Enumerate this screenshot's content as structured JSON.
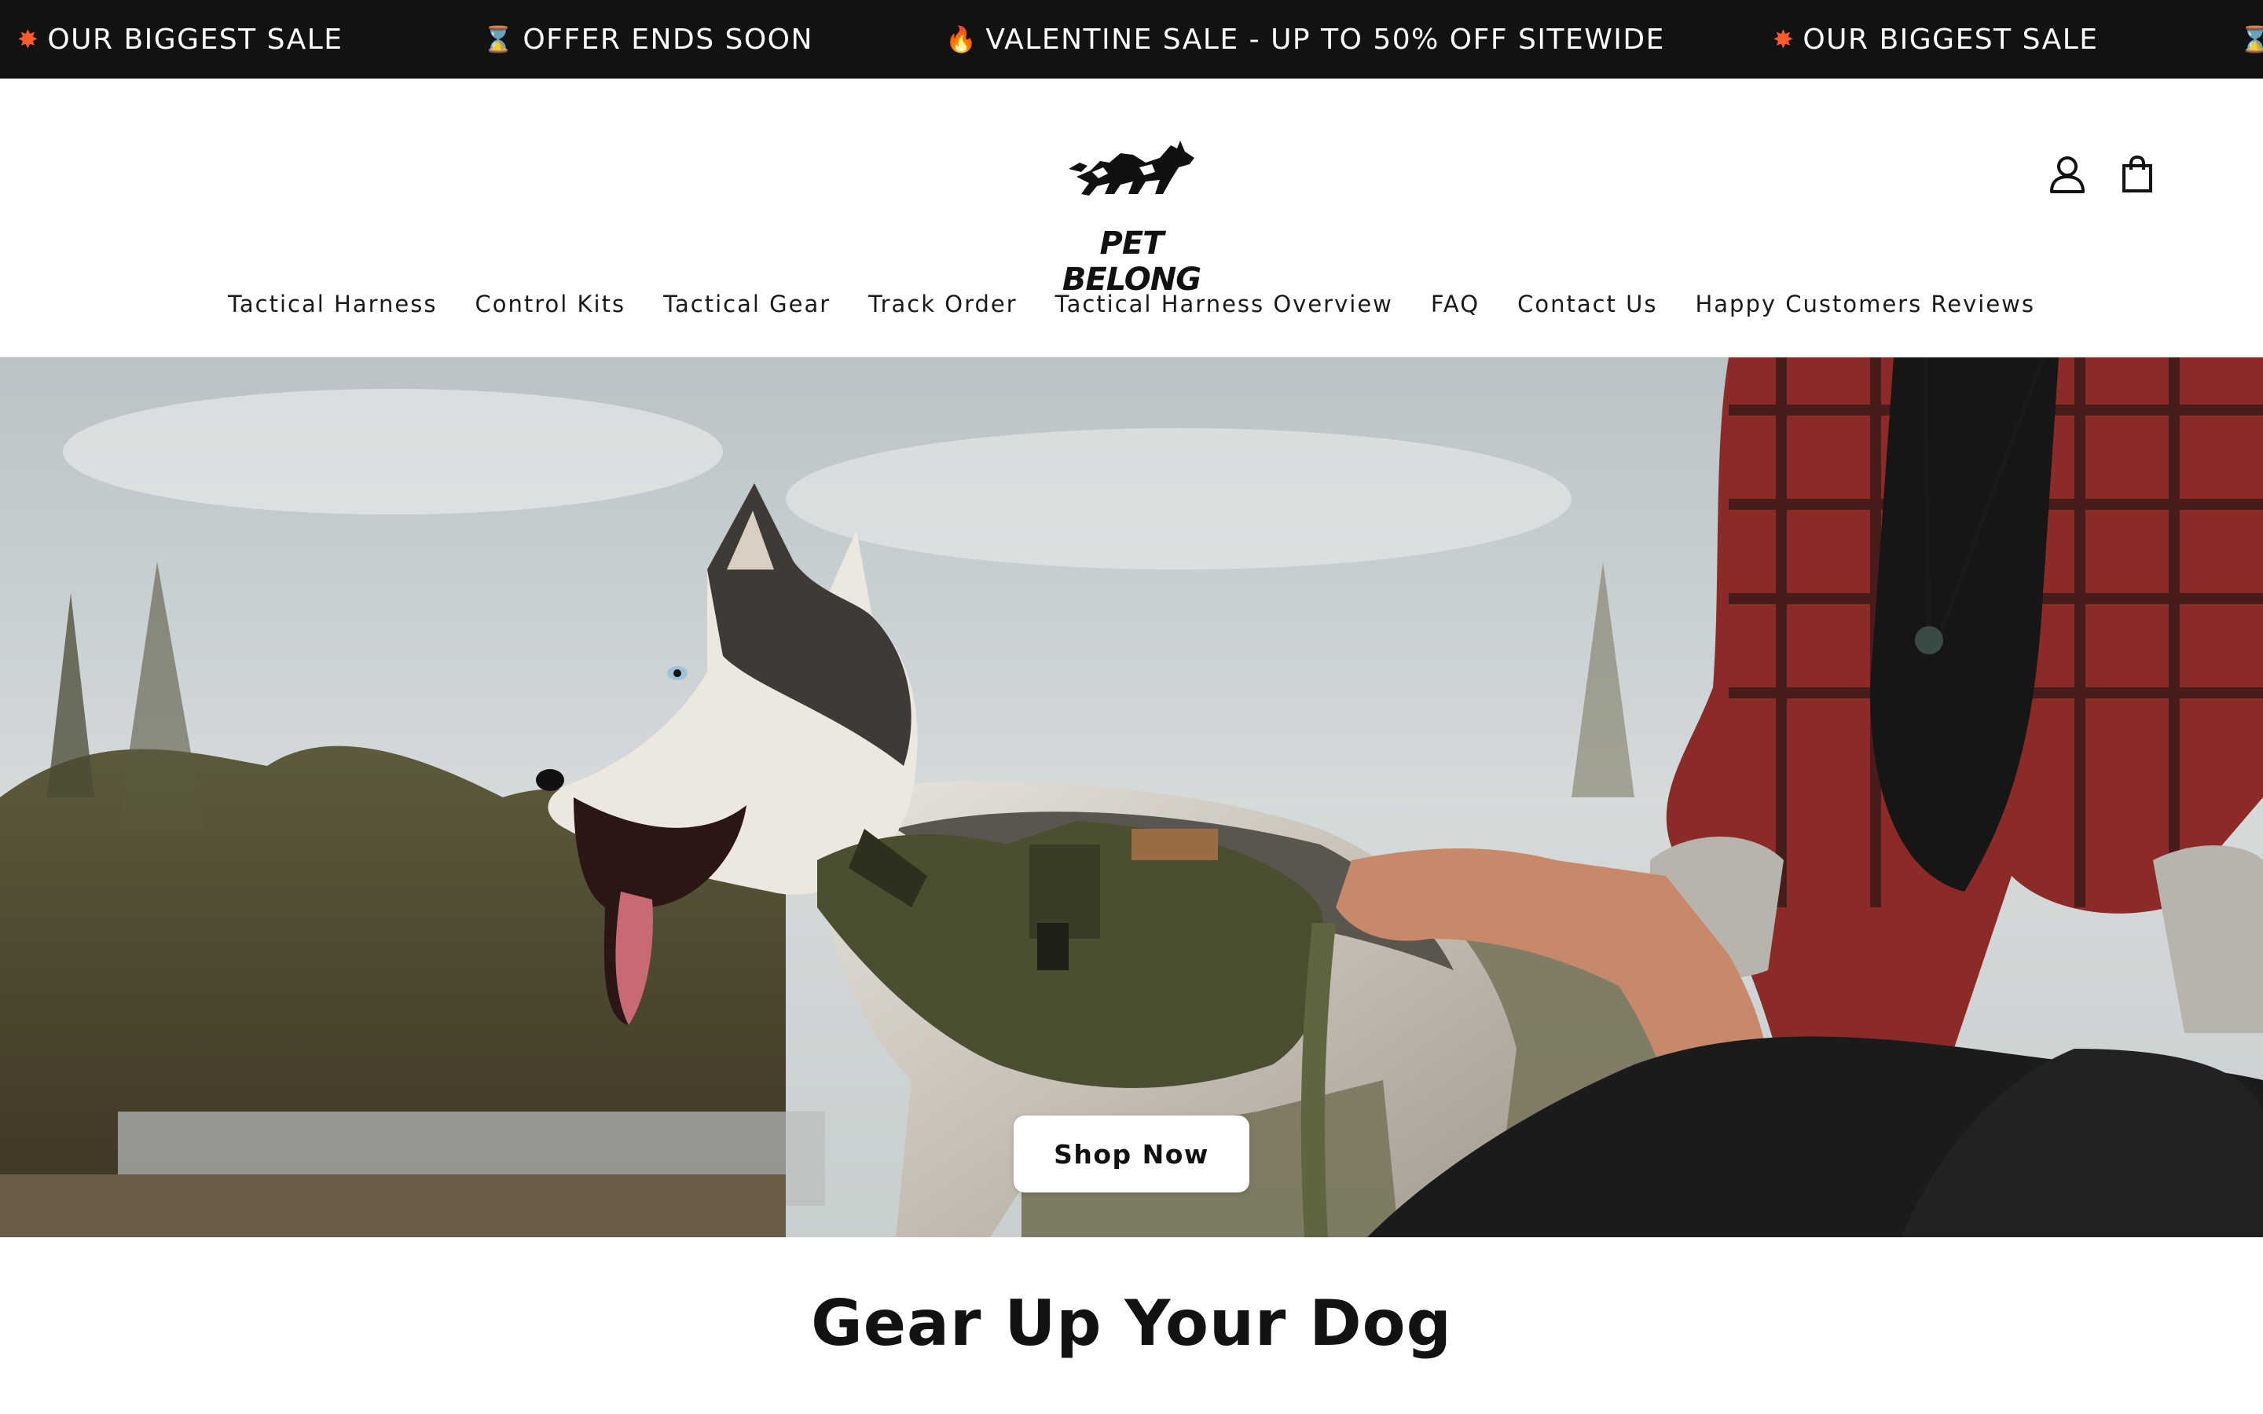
{
  "announcement": {
    "messages": [
      {
        "icon": "burst-icon",
        "text": "OUR BIGGEST SALE"
      },
      {
        "icon": "hourglass-icon",
        "text": "OFFER ENDS SOON"
      },
      {
        "icon": "fire-icon",
        "text": "VALENTINE SALE - UP TO 50% OFF SITEWIDE"
      },
      {
        "icon": "burst-icon",
        "text": "OUR BIGGEST SALE"
      }
    ]
  },
  "header": {
    "logo_text": "PET BELONG",
    "account_icon": "account-icon",
    "cart_icon": "cart-icon"
  },
  "nav": {
    "items": [
      {
        "label": "Tactical Harness"
      },
      {
        "label": "Control Kits"
      },
      {
        "label": "Tactical Gear"
      },
      {
        "label": "Track Order"
      },
      {
        "label": "Tactical Harness Overview"
      },
      {
        "label": "FAQ"
      },
      {
        "label": "Contact Us"
      },
      {
        "label": "Happy Customers Reviews"
      }
    ]
  },
  "hero": {
    "cta_label": "Shop Now"
  },
  "section": {
    "title": "Gear Up Your Dog"
  },
  "colors": {
    "announcement_bg": "#121212",
    "text": "#121212",
    "button_bg": "#ffffff"
  }
}
